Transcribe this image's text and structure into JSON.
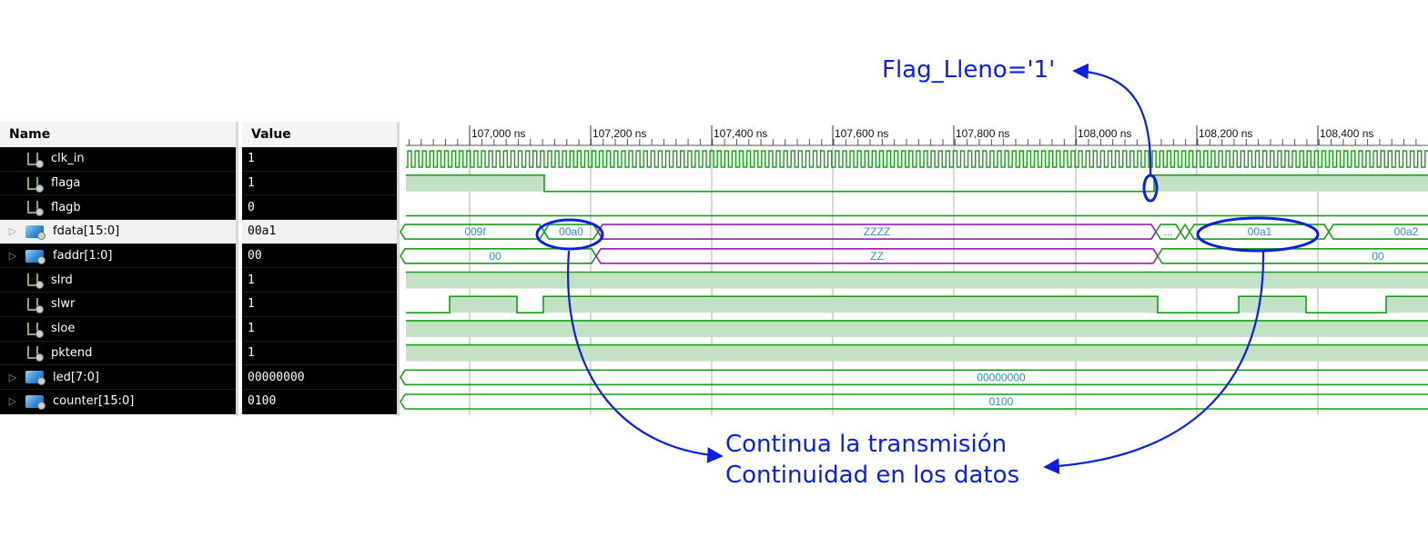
{
  "columns": {
    "name": "Name",
    "value": "Value"
  },
  "signals": [
    {
      "name": "clk_in",
      "value": "1",
      "kind": "bit",
      "expandable": false
    },
    {
      "name": "flaga",
      "value": "1",
      "kind": "bit",
      "expandable": false
    },
    {
      "name": "flagb",
      "value": "0",
      "kind": "bit",
      "expandable": false
    },
    {
      "name": "fdata[15:0]",
      "value": "00a1",
      "kind": "bus",
      "expandable": true,
      "selected": true
    },
    {
      "name": "faddr[1:0]",
      "value": "00",
      "kind": "bus",
      "expandable": true
    },
    {
      "name": "slrd",
      "value": "1",
      "kind": "bit",
      "expandable": false
    },
    {
      "name": "slwr",
      "value": "1",
      "kind": "bit",
      "expandable": false
    },
    {
      "name": "sloe",
      "value": "1",
      "kind": "bit",
      "expandable": false
    },
    {
      "name": "pktend",
      "value": "1",
      "kind": "bit",
      "expandable": false
    },
    {
      "name": "led[7:0]",
      "value": "00000000",
      "kind": "bus",
      "expandable": true
    },
    {
      "name": "counter[15:0]",
      "value": "0100",
      "kind": "bus",
      "expandable": true
    }
  ],
  "timeline": {
    "ticks": [
      "107,000 ns",
      "107,200 ns",
      "107,400 ns",
      "107,600 ns",
      "107,800 ns",
      "108,000 ns",
      "108,200 ns",
      "108,400 ns"
    ]
  },
  "bus_labels": {
    "fdata": [
      "009f",
      "00a0",
      "ZZZZ",
      "...",
      "00a1",
      "00a2"
    ],
    "faddr": [
      "00",
      "ZZ",
      "00"
    ],
    "led": [
      "00000000"
    ],
    "counter": [
      "0100"
    ]
  },
  "annotations": {
    "flag": "Flag_Lleno='1'",
    "line1": "Continua la transmisión",
    "line2": "Continuidad en los datos"
  },
  "colors": {
    "wave": "#16a016",
    "wave_fill": "#c3e1c3",
    "highz": "#9a1ab8",
    "bus_text": "#2a8ae0",
    "annotation": "#0a1fe0"
  }
}
